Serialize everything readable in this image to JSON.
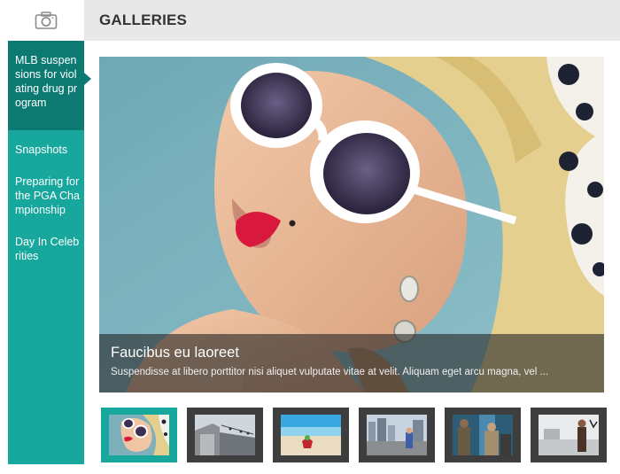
{
  "header": {
    "title": "GALLERIES"
  },
  "sidebar": {
    "icon": "camera-icon",
    "items": [
      {
        "label": "MLB suspensions for violating drug program",
        "active": true
      },
      {
        "label": "Snapshots",
        "active": false
      },
      {
        "label": "Preparing for the PGA Championship",
        "active": false
      },
      {
        "label": "Day In Celebrities",
        "active": false
      }
    ]
  },
  "main": {
    "caption_title": "Faucibus eu laoreet",
    "caption_text": "Suspendisse at libero porttitor nisi aliquet vulputate vitae at velit. Aliquam eget arcu magna, vel ..."
  },
  "thumbnails": {
    "count": 6,
    "active_index": 0
  },
  "colors": {
    "accent": "#18a79c",
    "accent_dark": "#0d7a72",
    "header_bg": "#e8e8e8",
    "thumb_bg": "#3e3e3e"
  }
}
